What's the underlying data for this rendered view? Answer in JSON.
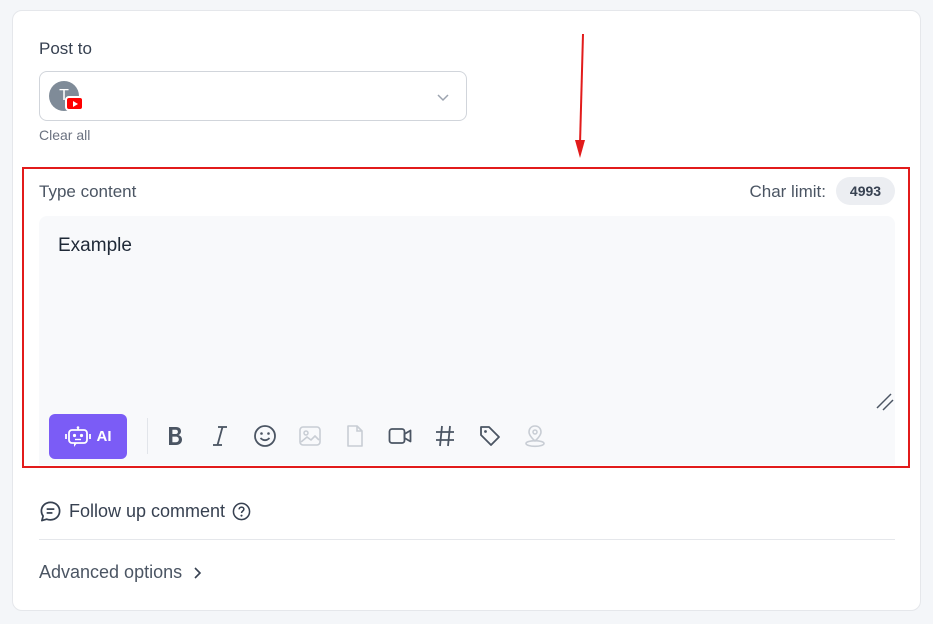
{
  "post_to": {
    "label": "Post to",
    "avatar_initial": "T",
    "platform_badge_icon": "youtube-icon",
    "chevron_icon": "chevron-down-icon",
    "clear_all": "Clear all"
  },
  "content": {
    "label": "Type content",
    "char_limit_label": "Char limit:",
    "char_limit_value": "4993",
    "text": "Example"
  },
  "toolbar": {
    "ai_label": "AI",
    "tools": [
      "robot-icon",
      "bold-icon",
      "italic-icon",
      "emoji-icon",
      "image-icon",
      "file-icon",
      "video-icon",
      "hashtag-icon",
      "tag-icon",
      "location-icon"
    ]
  },
  "follow_up": {
    "label": "Follow up comment"
  },
  "advanced": {
    "label": "Advanced options"
  },
  "colors": {
    "accent": "#7b5cf6",
    "highlight_border": "#e21b1b",
    "annotation_arrow": "#e21b1b"
  }
}
